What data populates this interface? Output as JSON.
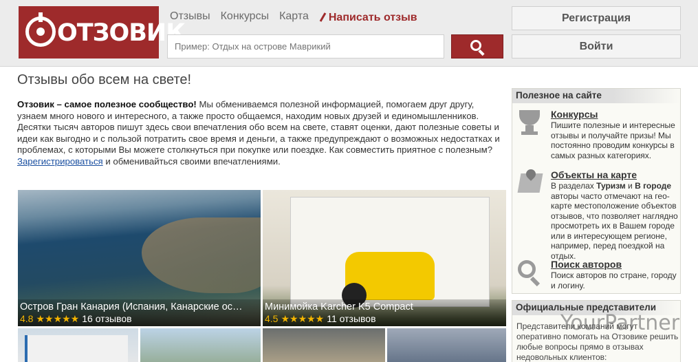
{
  "header": {
    "logo_text": "ОТЗОВИК",
    "nav": [
      "Отзывы",
      "Конкурсы",
      "Карта"
    ],
    "write_review": "Написать отзыв",
    "search_placeholder": "Пример: Отдых на острове Маврикий",
    "register": "Регистрация",
    "login": "Войти"
  },
  "main": {
    "title": "Отзывы обо всем на свете!",
    "intro_bold": "Отзовик – самое полезное сообщество!",
    "intro_text": " Мы обмениваемся полезной информацией, помогаем друг другу, узнаем много нового и интересного, а также просто общаемся, находим новых друзей и единомышленников. Десятки тысяч авторов пишут здесь свои впечатления обо всем на свете, ставят оценки, дают полезные советы и идеи как выгодно и с пользой потратить свое время и деньги, а также предупреждают о возможных недостатках и проблемах, с которыми Вы можете столкнуться при покупке или поездке. Как совместить приятное с полезным? ",
    "intro_link": "Зарегистрироваться",
    "intro_tail": " и обменивайться своими впечатлениями.",
    "tiles": [
      {
        "title": "Остров Гран Канария (Испания, Канарские ос…",
        "rating": "4.8",
        "stars": "★★★★★",
        "reviews": "16 отзывов"
      },
      {
        "title": "Минимойка Karcher K5 Compact",
        "rating": "4.5",
        "stars": "★★★★★",
        "reviews": "11 отзывов"
      }
    ]
  },
  "sidebar": {
    "useful_title": "Полезное на сайте",
    "items": [
      {
        "link": "Конкурсы",
        "text": "Пишите полезные и интересные отзывы и получайте призы! Мы постоянно проводим конкурсы в самых разных категориях.",
        "icon": "trophy-icon"
      },
      {
        "link": "Объекты на карте",
        "text_pre": "В разделах ",
        "b1": "Туризм",
        "mid": " и ",
        "b2": "В городе",
        "text_post": " авторы часто отмечают на гео-карте местоположение объектов отзывов, что позволяет наглядно просмотреть их в Вашем городе или в интересующем регионе, например, перед поездкой на отдых.",
        "icon": "map-icon"
      },
      {
        "link": "Поиск авторов",
        "text": "Поиск авторов по стране, городу и логину.",
        "icon": "magnifier-icon"
      }
    ],
    "official_title": "Официальные представители",
    "official_text": "Представители компаний могут оперативно помогать на Отзовике решить любые вопросы прямо в отзывах недовольных клиентов:"
  },
  "watermark": "YourPartner"
}
